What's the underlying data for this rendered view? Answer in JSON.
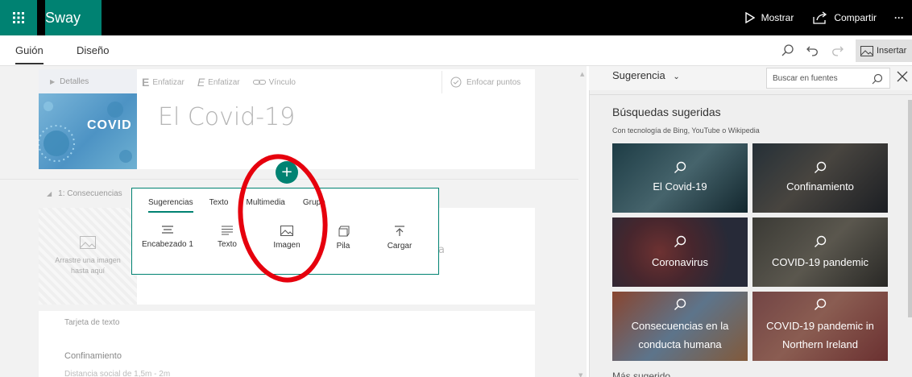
{
  "app": {
    "title": "Sway"
  },
  "topbar": {
    "mostrar": "Mostrar",
    "compartir": "Compartir",
    "more": "···"
  },
  "tabs": [
    {
      "label": "Guión"
    },
    {
      "label": "Diseño"
    }
  ],
  "toolbar": {
    "insertar": "Insertar"
  },
  "title_card": {
    "details": "Detalles",
    "format": {
      "enfatizar1": "Enfatizar",
      "enfatizar2": "Enfatizar",
      "vinculo": "Vínculo",
      "enfocar": "Enfocar puntos"
    },
    "title": "El Covid-19",
    "thumb_text": "COVID"
  },
  "section": {
    "label": "1: Consecuencias"
  },
  "image_card": {
    "drop_text_1": "Arrastre una imagen",
    "drop_text_2": "hasta aquí"
  },
  "text_card": {
    "label": "Tarjeta de texto",
    "heading": "Confinamiento",
    "body": "Distancia social de 1,5m - 2m"
  },
  "insert_popup": {
    "plus": "+",
    "tabs": [
      {
        "label": "Sugerencias"
      },
      {
        "label": "Texto"
      },
      {
        "label": "Multimedia"
      },
      {
        "label": "Grupo"
      }
    ],
    "items": [
      {
        "label": "Encabezado 1"
      },
      {
        "label": "Texto"
      },
      {
        "label": "Imagen"
      },
      {
        "label": "Pila"
      },
      {
        "label": "Cargar"
      }
    ]
  },
  "pane": {
    "dropdown": "Sugerencia",
    "search_placeholder": "Buscar en fuentes",
    "heading": "Búsquedas sugeridas",
    "sub": "Con tecnología de Bing, YouTube o Wikipedia",
    "tiles": [
      {
        "label": "El Covid-19"
      },
      {
        "label": "Confinamiento"
      },
      {
        "label": "Coronavirus"
      },
      {
        "label": "COVID-19 pandemic"
      },
      {
        "label_1": "Consecuencias en la",
        "label_2": "conducta humana"
      },
      {
        "label_1": "COVID-19 pandemic in",
        "label_2": "Northern Ireland"
      }
    ],
    "bottom": "Más sugerido"
  }
}
